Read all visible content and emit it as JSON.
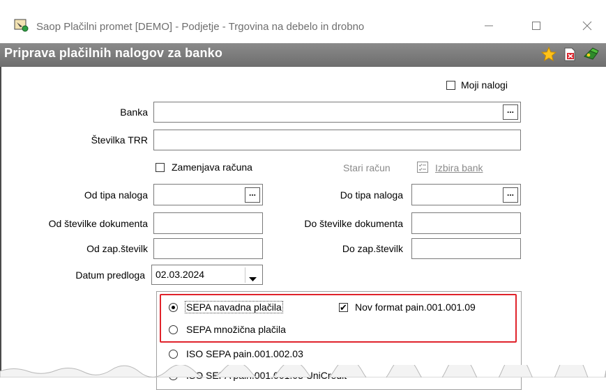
{
  "window": {
    "title": "Saop Plačilni promet [DEMO] - Podjetje - Trgovina na debelo in drobno"
  },
  "header": {
    "title": "Priprava plačilnih nalogov za banko"
  },
  "form": {
    "moji_nalogi": {
      "label": "Moji nalogi",
      "checked": false
    },
    "banka": {
      "label": "Banka",
      "value": ""
    },
    "stevilka_trr": {
      "label": "Številka TRR",
      "value": ""
    },
    "zamenjava_racuna": {
      "label": "Zamenjava računa",
      "checked": false
    },
    "stari_racun": {
      "label": "Stari račun"
    },
    "izbira_bank": {
      "label": "Izbira bank"
    },
    "od_tipa_naloga": {
      "label": "Od tipa naloga",
      "value": ""
    },
    "do_tipa_naloga": {
      "label": "Do tipa naloga",
      "value": ""
    },
    "od_stevilke_dokumenta": {
      "label": "Od številke dokumenta",
      "value": ""
    },
    "do_stevilke_dokumenta": {
      "label": "Do številke dokumenta",
      "value": ""
    },
    "od_zap_stevilk": {
      "label": "Od zap.številk",
      "value": ""
    },
    "do_zap_stevilk": {
      "label": "Do zap.številk",
      "value": ""
    },
    "datum_predloga": {
      "label": "Datum predloga",
      "value": "02.03.2024"
    },
    "ellipsis": "...",
    "check_mark": "✔",
    "payment_options": [
      {
        "label": "SEPA navadna plačila",
        "selected": true
      },
      {
        "label": "SEPA množična plačila",
        "selected": false
      },
      {
        "label": "ISO SEPA pain.001.002.03",
        "selected": false
      },
      {
        "label": "ISO SEPA pain.001.001.03 UniCredit",
        "selected": false
      }
    ],
    "nov_format": {
      "label": "Nov format pain.001.001.09",
      "checked": true
    }
  },
  "colors": {
    "header_bg": "#7a7a7a",
    "highlight_border": "#e0232b"
  },
  "icons": [
    "app-icon",
    "minimize-icon",
    "maximize-icon",
    "close-icon",
    "star-icon",
    "pdf-icon",
    "exit-icon",
    "list-icon",
    "dropdown-arrow-icon"
  ]
}
